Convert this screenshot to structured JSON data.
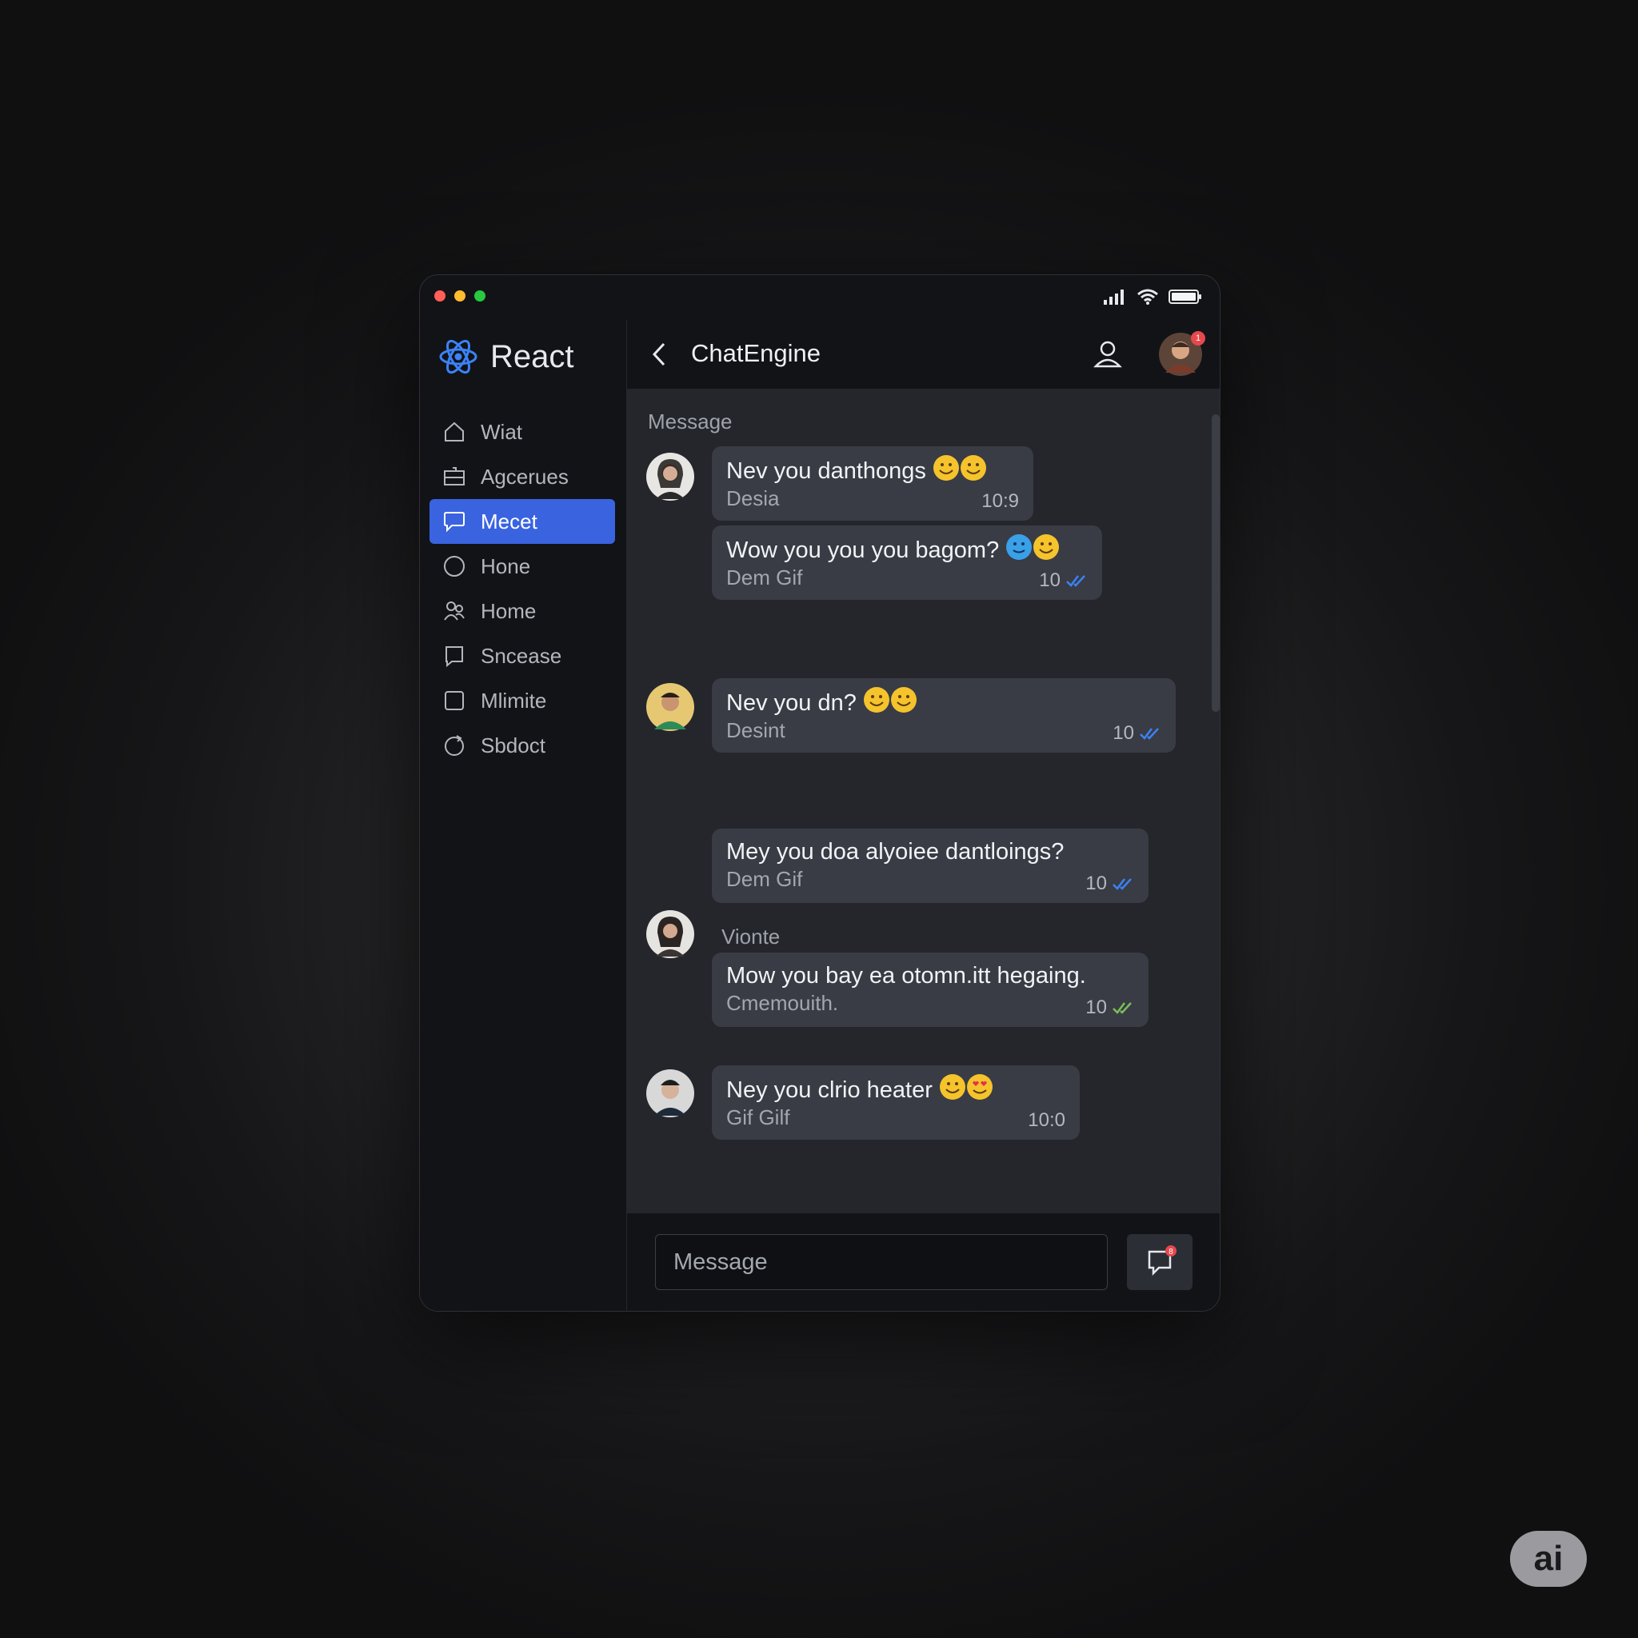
{
  "sidebar": {
    "brand": "React",
    "items": [
      {
        "label": "Wiat",
        "icon": "home-icon",
        "active": false
      },
      {
        "label": "Agcerues",
        "icon": "inbox-icon",
        "active": false
      },
      {
        "label": "Mecet",
        "icon": "chat-bubble-icon",
        "active": true
      },
      {
        "label": "Hone",
        "icon": "circle-icon",
        "active": false
      },
      {
        "label": "Home",
        "icon": "people-icon",
        "active": false
      },
      {
        "label": "Sncease",
        "icon": "message-square-icon",
        "active": false
      },
      {
        "label": "Mlimite",
        "icon": "square-icon",
        "active": false
      },
      {
        "label": "Sbdoct",
        "icon": "refresh-circle-icon",
        "active": false
      }
    ]
  },
  "header": {
    "title": "ChatEngine",
    "avatar_badge": "1"
  },
  "messages": {
    "section_label": "Message",
    "items": [
      {
        "text": "Nev you danthongs",
        "sub": "Desia",
        "time": "10:9",
        "read": false
      },
      {
        "text": "Wow you you you bagom?",
        "sub": "Dem Gif",
        "time": "10",
        "read": true
      },
      {
        "text": "Nev you dn?",
        "sub": "Desint",
        "time": "10",
        "read": true
      },
      {
        "text": "Mey you doa alyoiee dantloings?",
        "sub": "Dem Gif",
        "time": "10",
        "read": true
      },
      {
        "sender": "Vionte",
        "text": "Mow you bay ea otomn.itt hegaing.",
        "sub": "Cmemouith.",
        "time": "10",
        "read": true
      },
      {
        "text": "Ney you clrio heater",
        "sub": "Gif Gilf",
        "time": "10:0",
        "read": false
      }
    ]
  },
  "composer": {
    "placeholder": "Message",
    "send_badge": "8"
  },
  "watermark": "ai",
  "colors": {
    "accent": "#3a63e0",
    "bubble": "#393c44",
    "read_tick": "#3b82f6",
    "read_tick_alt": "#7bbf5a"
  }
}
